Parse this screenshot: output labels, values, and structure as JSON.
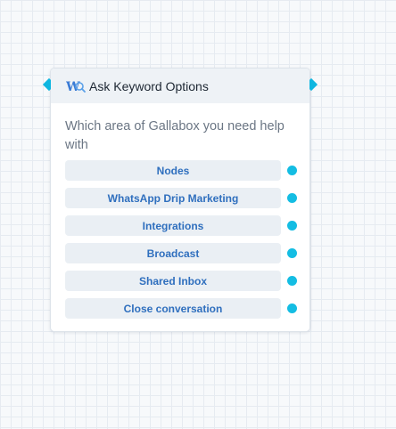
{
  "node": {
    "icon": "keyword-options-icon",
    "title": "Ask Keyword Options",
    "question": "Which area of Gallabox you need help with",
    "options": [
      "Nodes",
      "WhatsApp Drip Marketing",
      "Integrations",
      "Broadcast",
      "Shared Inbox",
      "Close conversation"
    ]
  },
  "colors": {
    "accent": "#14bde3",
    "option_text": "#2f6fbe",
    "option_bg": "#eaeff4",
    "header_bg": "#eef2f6"
  }
}
